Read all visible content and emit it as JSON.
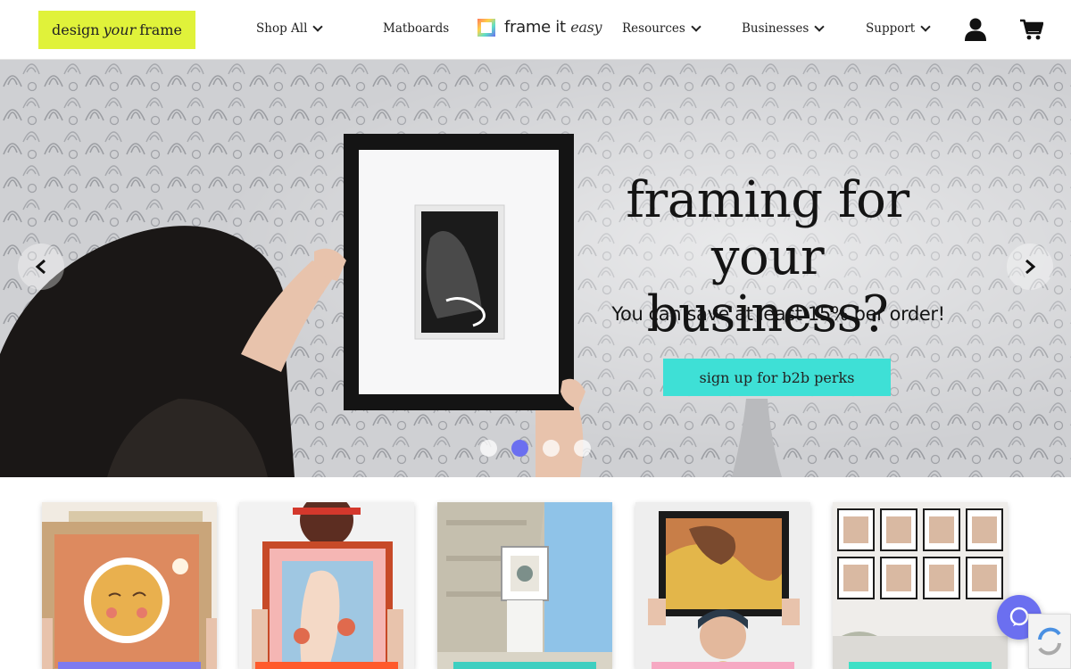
{
  "nav": {
    "brand": {
      "pre": "design",
      "em": "your",
      "post": "frame"
    },
    "links": [
      {
        "label": "Shop All",
        "has_dropdown": true
      },
      {
        "label": "Matboards",
        "has_dropdown": false
      },
      {
        "label": "Resources",
        "has_dropdown": true
      },
      {
        "label": "Businesses",
        "has_dropdown": true
      },
      {
        "label": "Support",
        "has_dropdown": true
      }
    ],
    "logo": {
      "main": "frame it",
      "em": "easy"
    },
    "icons": [
      "user-icon",
      "cart-icon"
    ]
  },
  "hero": {
    "title_line1": "framing for",
    "title_line2": "your business?",
    "subtitle": "You can save at least 15% per order!",
    "cta_label": "sign up for b2b perks",
    "slides_count": 4,
    "active_slide": 2
  },
  "cards": [
    {
      "theme": "sun illustration frame",
      "band_color": "#7d7af0"
    },
    {
      "theme": "woman holding pink framed art",
      "band_color": "#ff5a2b"
    },
    {
      "theme": "person holding framed print outdoors",
      "band_color": "#3ecfc0"
    },
    {
      "theme": "woman holding black framed photo",
      "band_color": "#f6a9c3"
    },
    {
      "theme": "gallery wall of framed photos",
      "band_color": "#3ee0c6"
    }
  ],
  "colors": {
    "brand_yellow": "#e0f23a",
    "cta_teal": "#3ee0d6",
    "accent_purple": "#6b6ff0"
  }
}
